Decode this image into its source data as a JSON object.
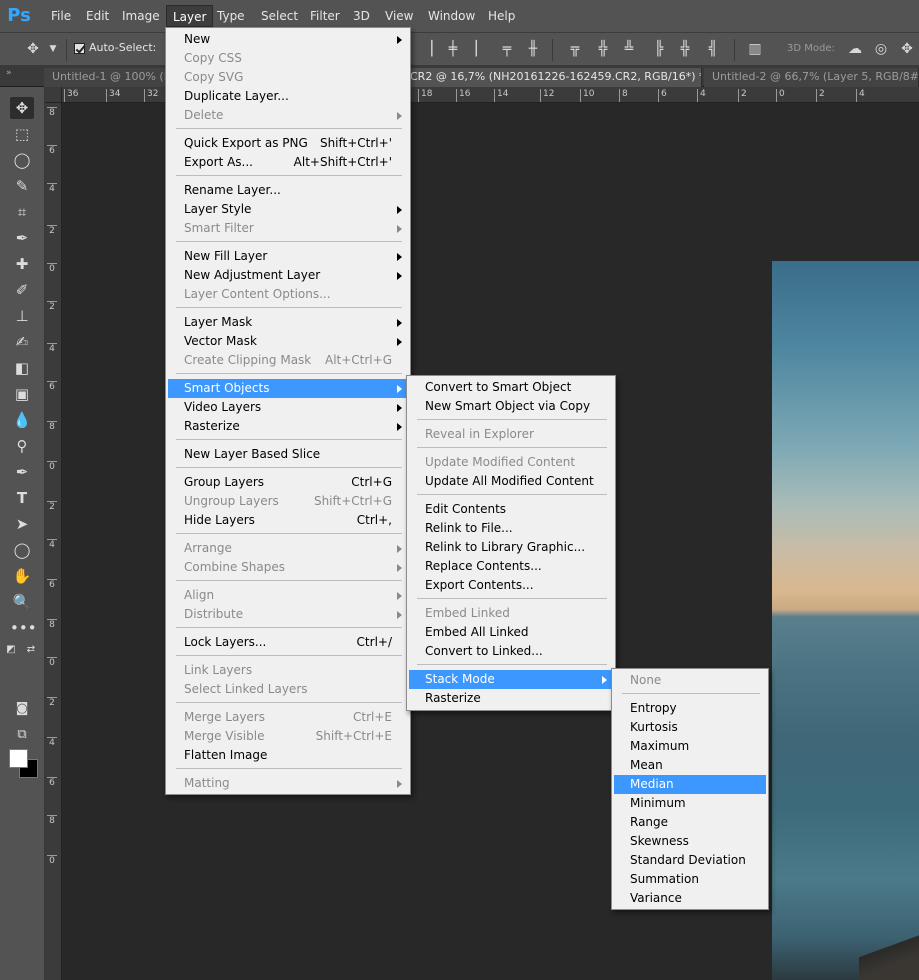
{
  "app": {
    "logo": "Ps",
    "accent": "#31a8ff",
    "highlight": "#3c98ff"
  },
  "menubar": [
    "File",
    "Edit",
    "Image",
    "Layer",
    "Type",
    "Select",
    "Filter",
    "3D",
    "View",
    "Window",
    "Help"
  ],
  "options": {
    "autoselect_label": "Auto-Select:",
    "autoselect_checked": true,
    "mode3d_label": "3D Mode:"
  },
  "tabs": [
    {
      "label": "Untitled-1 @ 100% (L",
      "active": false,
      "close": ""
    },
    {
      "label": "CR2 @ 16,7% (NH20161226-162459.CR2, RGB/16*) *",
      "active": true,
      "close": "×"
    },
    {
      "label": "Untitled-2 @ 66,7% (Layer 5, RGB/8#) *",
      "active": false,
      "close": "×"
    }
  ],
  "ruler_top": [
    "36",
    "34",
    "32",
    "18",
    "16",
    "14",
    "12",
    "10",
    "8",
    "6",
    "4",
    "2",
    "0",
    "2",
    "4"
  ],
  "ruler_left": [
    "8",
    "6",
    "4",
    "2",
    "0",
    "2",
    "4",
    "6",
    "8",
    "0",
    "2",
    "4",
    "6",
    "8",
    "0",
    "2",
    "4",
    "6",
    "8",
    "0"
  ],
  "layer_menu": [
    {
      "label": "New",
      "shortcut": "",
      "arrow": true,
      "disabled": false
    },
    {
      "label": "Copy CSS",
      "shortcut": "",
      "arrow": false,
      "disabled": true
    },
    {
      "label": "Copy SVG",
      "shortcut": "",
      "arrow": false,
      "disabled": true
    },
    {
      "label": "Duplicate Layer...",
      "shortcut": "",
      "arrow": false,
      "disabled": false
    },
    {
      "label": "Delete",
      "shortcut": "",
      "arrow": true,
      "disabled": true
    },
    {
      "sep": true
    },
    {
      "label": "Quick Export as PNG",
      "shortcut": "Shift+Ctrl+'",
      "arrow": false,
      "disabled": false
    },
    {
      "label": "Export As...",
      "shortcut": "Alt+Shift+Ctrl+'",
      "arrow": false,
      "disabled": false
    },
    {
      "sep": true
    },
    {
      "label": "Rename Layer...",
      "shortcut": "",
      "arrow": false,
      "disabled": false
    },
    {
      "label": "Layer Style",
      "shortcut": "",
      "arrow": true,
      "disabled": false
    },
    {
      "label": "Smart Filter",
      "shortcut": "",
      "arrow": true,
      "disabled": true
    },
    {
      "sep": true
    },
    {
      "label": "New Fill Layer",
      "shortcut": "",
      "arrow": true,
      "disabled": false
    },
    {
      "label": "New Adjustment Layer",
      "shortcut": "",
      "arrow": true,
      "disabled": false
    },
    {
      "label": "Layer Content Options...",
      "shortcut": "",
      "arrow": false,
      "disabled": true
    },
    {
      "sep": true
    },
    {
      "label": "Layer Mask",
      "shortcut": "",
      "arrow": true,
      "disabled": false
    },
    {
      "label": "Vector Mask",
      "shortcut": "",
      "arrow": true,
      "disabled": false
    },
    {
      "label": "Create Clipping Mask",
      "shortcut": "Alt+Ctrl+G",
      "arrow": false,
      "disabled": true
    },
    {
      "sep": true
    },
    {
      "label": "Smart Objects",
      "shortcut": "",
      "arrow": true,
      "disabled": false,
      "highlight": true
    },
    {
      "label": "Video Layers",
      "shortcut": "",
      "arrow": true,
      "disabled": false
    },
    {
      "label": "Rasterize",
      "shortcut": "",
      "arrow": true,
      "disabled": false
    },
    {
      "sep": true
    },
    {
      "label": "New Layer Based Slice",
      "shortcut": "",
      "arrow": false,
      "disabled": false
    },
    {
      "sep": true
    },
    {
      "label": "Group Layers",
      "shortcut": "Ctrl+G",
      "arrow": false,
      "disabled": false
    },
    {
      "label": "Ungroup Layers",
      "shortcut": "Shift+Ctrl+G",
      "arrow": false,
      "disabled": true
    },
    {
      "label": "Hide Layers",
      "shortcut": "Ctrl+,",
      "arrow": false,
      "disabled": false
    },
    {
      "sep": true
    },
    {
      "label": "Arrange",
      "shortcut": "",
      "arrow": true,
      "disabled": true
    },
    {
      "label": "Combine Shapes",
      "shortcut": "",
      "arrow": true,
      "disabled": true
    },
    {
      "sep": true
    },
    {
      "label": "Align",
      "shortcut": "",
      "arrow": true,
      "disabled": true
    },
    {
      "label": "Distribute",
      "shortcut": "",
      "arrow": true,
      "disabled": true
    },
    {
      "sep": true
    },
    {
      "label": "Lock Layers...",
      "shortcut": "Ctrl+/",
      "arrow": false,
      "disabled": false
    },
    {
      "sep": true
    },
    {
      "label": "Link Layers",
      "shortcut": "",
      "arrow": false,
      "disabled": true
    },
    {
      "label": "Select Linked Layers",
      "shortcut": "",
      "arrow": false,
      "disabled": true
    },
    {
      "sep": true
    },
    {
      "label": "Merge Layers",
      "shortcut": "Ctrl+E",
      "arrow": false,
      "disabled": true
    },
    {
      "label": "Merge Visible",
      "shortcut": "Shift+Ctrl+E",
      "arrow": false,
      "disabled": true
    },
    {
      "label": "Flatten Image",
      "shortcut": "",
      "arrow": false,
      "disabled": false
    },
    {
      "sep": true
    },
    {
      "label": "Matting",
      "shortcut": "",
      "arrow": true,
      "disabled": true
    }
  ],
  "smart_objects_menu": [
    {
      "label": "Convert to Smart Object",
      "disabled": false
    },
    {
      "label": "New Smart Object via Copy",
      "disabled": false
    },
    {
      "sep": true
    },
    {
      "label": "Reveal in Explorer",
      "disabled": true
    },
    {
      "sep": true
    },
    {
      "label": "Update Modified Content",
      "disabled": true
    },
    {
      "label": "Update All Modified Content",
      "disabled": false
    },
    {
      "sep": true
    },
    {
      "label": "Edit Contents",
      "disabled": false
    },
    {
      "label": "Relink to File...",
      "disabled": false
    },
    {
      "label": "Relink to Library Graphic...",
      "disabled": false
    },
    {
      "label": "Replace Contents...",
      "disabled": false
    },
    {
      "label": "Export Contents...",
      "disabled": false
    },
    {
      "sep": true
    },
    {
      "label": "Embed Linked",
      "disabled": true
    },
    {
      "label": "Embed All Linked",
      "disabled": false
    },
    {
      "label": "Convert to Linked...",
      "disabled": false
    },
    {
      "sep": true
    },
    {
      "label": "Stack Mode",
      "disabled": false,
      "arrow": true,
      "highlight": true
    },
    {
      "label": "Rasterize",
      "disabled": false
    }
  ],
  "stack_mode_menu": [
    {
      "label": "None",
      "disabled": true
    },
    {
      "sep": true
    },
    {
      "label": "Entropy",
      "disabled": false
    },
    {
      "label": "Kurtosis",
      "disabled": false
    },
    {
      "label": "Maximum",
      "disabled": false
    },
    {
      "label": "Mean",
      "disabled": false
    },
    {
      "label": "Median",
      "disabled": false,
      "highlight": true
    },
    {
      "label": "Minimum",
      "disabled": false
    },
    {
      "label": "Range",
      "disabled": false
    },
    {
      "label": "Skewness",
      "disabled": false
    },
    {
      "label": "Standard Deviation",
      "disabled": false
    },
    {
      "label": "Summation",
      "disabled": false
    },
    {
      "label": "Variance",
      "disabled": false
    }
  ],
  "tools": [
    "move-icon",
    "marquee-icon",
    "lasso-icon",
    "quick-select-icon",
    "crop-icon",
    "eyedropper-icon",
    "healing-brush-icon",
    "brush-icon",
    "clone-stamp-icon",
    "history-brush-icon",
    "eraser-icon",
    "gradient-icon",
    "blur-icon",
    "dodge-icon",
    "pen-icon",
    "type-icon",
    "path-select-icon",
    "ellipse-icon",
    "hand-icon",
    "zoom-icon",
    "more-tools-icon"
  ]
}
